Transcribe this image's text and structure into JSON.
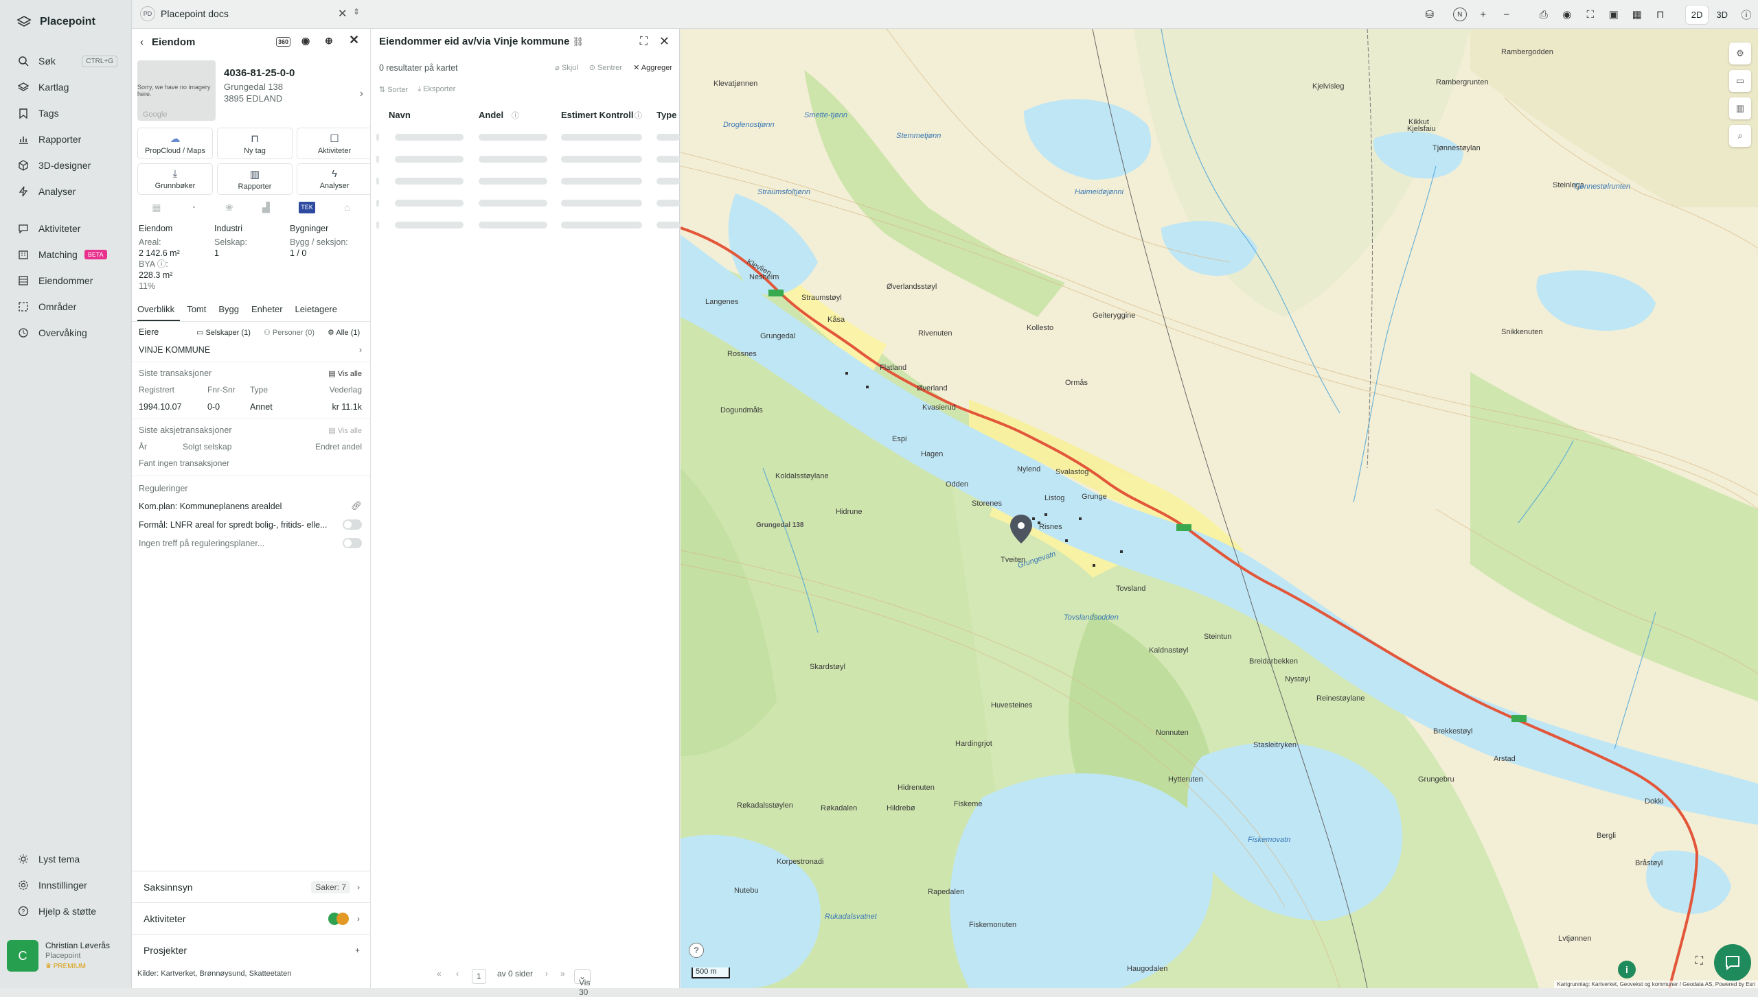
{
  "app": {
    "name": "Placepoint"
  },
  "sidebar": {
    "items": [
      {
        "label": "Søk",
        "kbd": "CTRL+G"
      },
      {
        "label": "Kartlag"
      },
      {
        "label": "Tags"
      },
      {
        "label": "Rapporter"
      },
      {
        "label": "3D-designer"
      },
      {
        "label": "Analyser"
      },
      {
        "label": "Aktiviteter"
      },
      {
        "label": "Matching",
        "badge": "BETA"
      },
      {
        "label": "Eiendommer"
      },
      {
        "label": "Områder"
      },
      {
        "label": "Overvåking"
      }
    ],
    "bottom": [
      {
        "label": "Lyst tema"
      },
      {
        "label": "Innstillinger"
      },
      {
        "label": "Hjelp & støtte"
      }
    ],
    "user": {
      "initial": "C",
      "name": "Christian Løverås",
      "org": "Placepoint",
      "plan": "PREMIUM"
    }
  },
  "topbar": {
    "docs_badge": "PD",
    "docs_title": "Placepoint docs",
    "view_2d": "2D",
    "view_3d": "3D"
  },
  "property_panel": {
    "title": "Eiendom",
    "thumb_text": "Sorry, we have no imagery here.",
    "thumb_google": "Google",
    "id": "4036-81-25-0-0",
    "address": "Grungedal 138",
    "postal": "3895 EDLAND",
    "buttons": [
      {
        "label": "PropCloud / Maps"
      },
      {
        "label": "Ny tag"
      },
      {
        "label": "Aktiviteter"
      },
      {
        "label": "Grunnbøker"
      },
      {
        "label": "Rapporter"
      },
      {
        "label": "Analyser"
      }
    ],
    "layer_tek": "TEK",
    "stats": {
      "col1_h": "Eiendom",
      "areal_l": "Areal:",
      "areal_v": "2 142.6 m²",
      "bya_l": "BYA ⓘ:",
      "bya_v": "228.3 m²",
      "bya_p": "11%",
      "col2_h": "Industri",
      "selskap_l": "Selskap:",
      "selskap_v": "1",
      "col3_h": "Bygninger",
      "bygg_l": "Bygg / seksjon:",
      "bygg_v": "1 / 0"
    },
    "tabs": [
      "Overblikk",
      "Tomt",
      "Bygg",
      "Enheter",
      "Leietagere"
    ],
    "owners": {
      "label": "Eiere",
      "f1": "Selskaper (1)",
      "f2": "Personer (0)",
      "f3": "Alle (1)",
      "owner": "VINJE KOMMUNE"
    },
    "transactions": {
      "title": "Siste transaksjoner",
      "view_all": "Vis alle",
      "cols": [
        "Registrert",
        "Fnr-Snr",
        "Type",
        "Vederlag"
      ],
      "row": [
        "1994.10.07",
        "0-0",
        "Annet",
        "kr 11.1k"
      ]
    },
    "share_tx": {
      "title": "Siste aksjetransaksjoner",
      "view_all": "Vis alle",
      "cols": [
        "År",
        "Solgt selskap",
        "Endret andel"
      ],
      "empty": "Fant ingen transaksjoner"
    },
    "regulations": {
      "title": "Reguleringer",
      "r1": "Kom.plan: Kommuneplanens arealdel",
      "r2": "Formål: LNFR areal for spredt bolig-, fritids- elle...",
      "r3": "Ingen treff på reguleringsplaner..."
    },
    "accordions": [
      {
        "label": "Saksinnsyn",
        "right": "Saker: 7"
      },
      {
        "label": "Aktiviteter",
        "right": ""
      },
      {
        "label": "Prosjekter",
        "right": "+"
      }
    ],
    "clients": "Kilder: Kartverket, Brønnøysund, Skatteetaten"
  },
  "results_panel": {
    "title": "Eiendommer eid av/via Vinje kommune",
    "subtitle": "0 resultater på kartet",
    "actions": [
      "Skjul",
      "Sentrer",
      "Aggreger"
    ],
    "actions2": [
      "Sorter",
      "Eksporter"
    ],
    "columns": [
      "Navn",
      "Andel",
      "Estimert Kontroll",
      "Type"
    ],
    "pager": {
      "page": "1",
      "of": "av 0 sider",
      "show": "Vis 30"
    }
  },
  "map": {
    "labels": [
      "Rambergodden",
      "Kjelvisleg",
      "Rambergrunten",
      "Kikkut",
      "Tjønnestøylan",
      "Steinlega",
      "Tjønnestølrunten",
      "Klevatjønnen",
      "Droglenostjønn",
      "Smette-tjønn",
      "Stemmetjønn",
      "Straumsfoltjønn",
      "Haimeidøjønni",
      "Oldrevatn",
      "Klevlien",
      "Nesheim",
      "Straumstøyl",
      "Langenes",
      "Kåsa",
      "Grungedal",
      "Rossnes",
      "Flatland",
      "Øverlandsstøyl",
      "Rivenuten",
      "Kollesto",
      "Geiteryggine",
      "Snikkenuten",
      "Ormås",
      "Dogundmåls",
      "Kvasierud",
      "Øverland",
      "Espi",
      "Hagen",
      "Svalastog",
      "Nylend",
      "Grunge",
      "Listog",
      "Odden",
      "Storenes",
      "Risnes",
      "Koldalsstøylane",
      "Hidrune",
      "Tveiten",
      "Grungevatn",
      "Tovsland",
      "Tovslandsodden",
      "Kaldnastøyl",
      "Steintun",
      "Breidarbekken",
      "Nystøyl",
      "Reinestøylane",
      "Skardstøyl",
      "Huvesteines",
      "Hardingrjot",
      "Nonnuten",
      "Stasleitryken",
      "Brekkestøyl",
      "Arstad",
      "Hytteruten",
      "Grungebru",
      "Hidrenuten",
      "Røkadalsstøylen",
      "Røkadalen",
      "Hildrebø",
      "Fiskeme",
      "Fiskemovatn",
      "Korpestronadi",
      "Rukadalsvatnet",
      "Rapedalen",
      "Fiskemonuten",
      "Haugodalen",
      "Dokki",
      "Bergli",
      "Bråstøyl",
      "Lvtjønnen",
      "Nutebu",
      "Kjelsfaiu",
      "Grungedal 138"
    ],
    "scale": "500 m",
    "attribution": "Kartgrunnlag: Kartverket, Geovekst og kommuner / Geodata AS, Powered by Esri"
  },
  "colors": {
    "accent_green": "#1f8a5c",
    "beta": "#e8308c",
    "road": "#e2563a",
    "water": "#bfe6f5",
    "forest": "#cfe7b0"
  }
}
